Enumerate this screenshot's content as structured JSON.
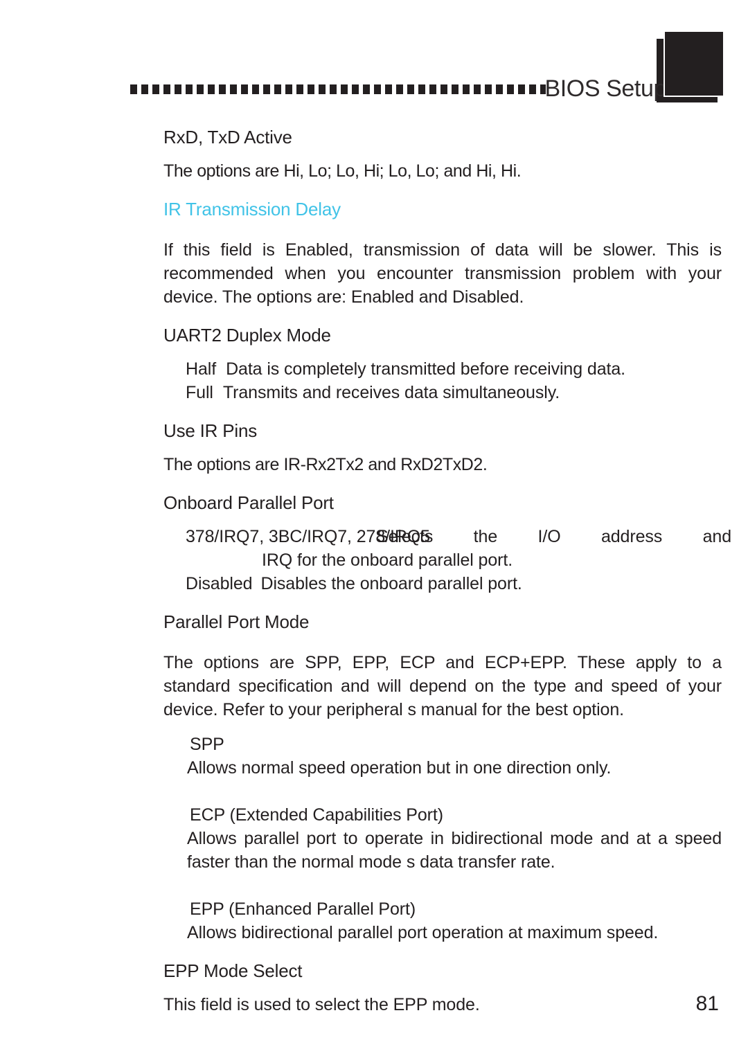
{
  "header": {
    "title": "BIOS Setup",
    "decoration": "dotted-rule",
    "accent_color": "#41c3e7",
    "text_color": "#231f20"
  },
  "sections": [
    {
      "id": "rxd-txd-active",
      "heading": "RxD, TxD Active",
      "heading_style": "plain",
      "body": "The options are Hi, Lo; Lo, Hi; Lo, Lo; and Hi, Hi."
    },
    {
      "id": "ir-transmission-delay",
      "heading": "IR Transmission Delay",
      "heading_style": "accent",
      "body": "If this field is Enabled, transmission of data will be slower. This is recommended when you encounter transmission problem with your device. The options are: Enabled and Disabled."
    },
    {
      "id": "uart2-duplex-mode",
      "heading": "UART2 Duplex Mode",
      "options": [
        {
          "label": "Half",
          "description": "Data is completely transmitted before receiving data."
        },
        {
          "label": "Full",
          "description": "Transmits and receives data simultaneously."
        }
      ]
    },
    {
      "id": "use-ir-pins",
      "heading": "Use IR Pins",
      "body": "The options are IR-Rx2Tx2 and RxD2TxD2."
    },
    {
      "id": "onboard-parallel-port",
      "heading": "Onboard Parallel Port",
      "overlap_left": "378/IRQ7, 3BC/IRQ7, 278/IRQ5",
      "overlap_right": "Selects the I/O address and",
      "continuation": "IRQ for the onboard parallel port.",
      "disabled_label": "Disabled",
      "disabled_description": "Disables the onboard parallel port."
    },
    {
      "id": "parallel-port-mode",
      "heading": "Parallel Port Mode",
      "body": "The options are SPP, EPP, ECP and ECP+EPP. These apply to a standard specification and will depend on the type and speed of your device. Refer to your peripheral s manual for the best option.",
      "modes": [
        {
          "name": "SPP",
          "description": "Allows normal speed operation but in one direction only."
        },
        {
          "name": "ECP (Extended Capabilities Port)",
          "description": "Allows parallel port to operate in bidirectional mode and at a speed faster than the normal mode s data transfer rate."
        },
        {
          "name": "EPP (Enhanced Parallel Port)",
          "description": "Allows bidirectional parallel port operation at maximum speed."
        }
      ]
    },
    {
      "id": "epp-mode-select",
      "heading": "EPP Mode Select",
      "body": "This field is used to select the EPP mode."
    }
  ],
  "footer": {
    "page_number": "81"
  }
}
